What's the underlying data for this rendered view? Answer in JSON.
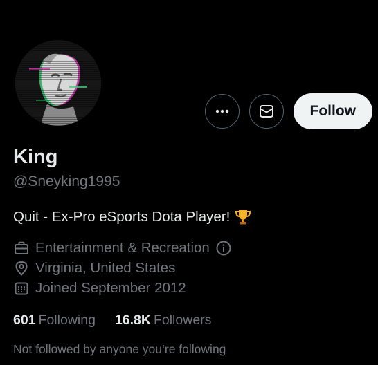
{
  "profile": {
    "display_name": "King",
    "handle": "@Sneyking1995",
    "bio": "Quit - Ex-Pro eSports Dota Player!",
    "bio_emoji": "trophy-icon"
  },
  "actions": {
    "more_icon": "more-dots-icon",
    "message_icon": "envelope-icon",
    "follow_label": "Follow"
  },
  "details": {
    "category": "Entertainment & Recreation",
    "category_icon": "briefcase-icon",
    "info_icon": "info-icon",
    "location": "Virginia, United States",
    "location_icon": "location-pin-icon",
    "joined": "Joined September 2012",
    "joined_icon": "calendar-icon"
  },
  "stats": {
    "following_count": "601",
    "following_label": "Following",
    "followers_count": "16.8K",
    "followers_label": "Followers"
  },
  "social_context": "Not followed by anyone you’re following",
  "colors": {
    "background": "#000000",
    "primary_text": "#e7e9ea",
    "secondary_text": "#71767b",
    "button_border": "#536471",
    "follow_bg": "#eff3f4"
  }
}
